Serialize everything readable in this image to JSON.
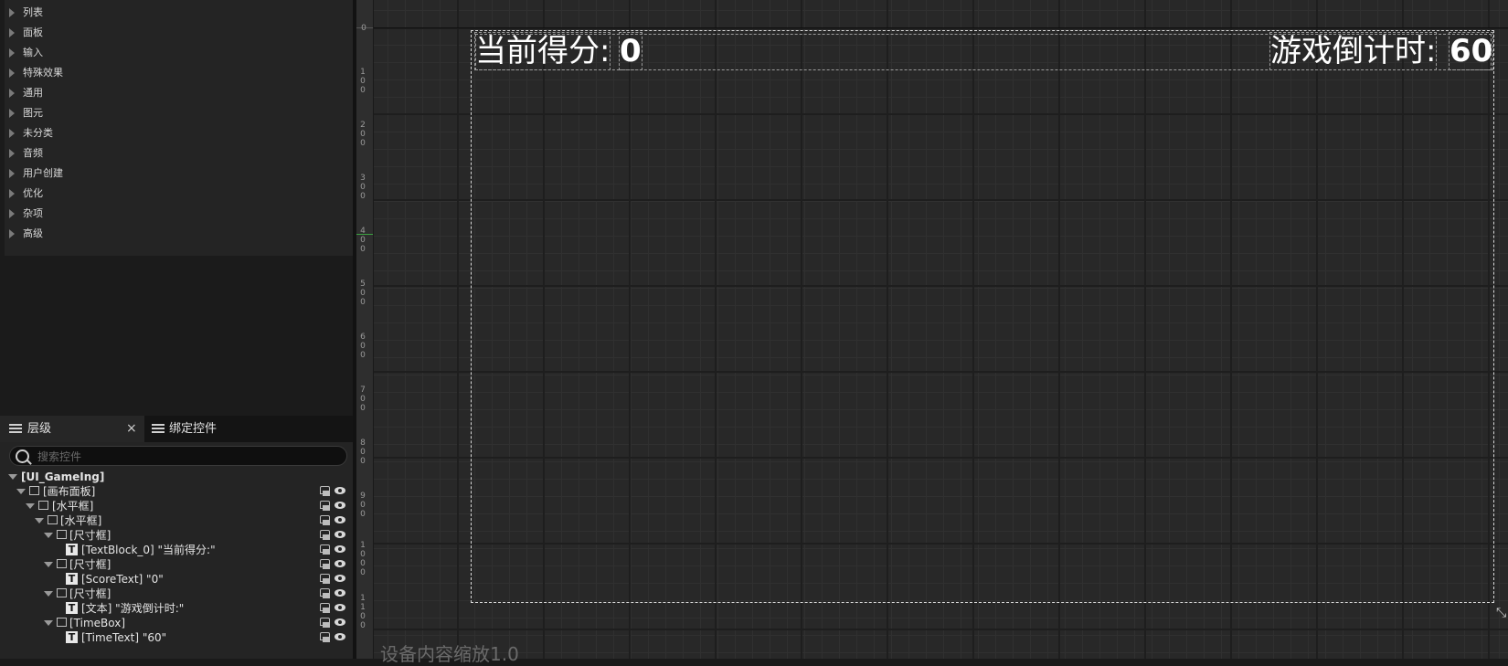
{
  "palette": {
    "categories": [
      "列表",
      "面板",
      "输入",
      "特殊效果",
      "通用",
      "图元",
      "未分类",
      "音频",
      "用户创建",
      "优化",
      "杂项",
      "高级"
    ]
  },
  "hierarchy": {
    "tab_label": "层级",
    "tab_close": "×",
    "bind_tab_label": "绑定控件",
    "search_placeholder": "搜索控件",
    "root": "[UI_GameIng]",
    "rows": [
      {
        "label": "[画布面板]"
      },
      {
        "label": "[水平框]"
      },
      {
        "label": "[水平框]"
      },
      {
        "label": "[尺寸框]"
      },
      {
        "label": "[TextBlock_0] \"当前得分:\""
      },
      {
        "label": "[尺寸框]"
      },
      {
        "label": "[ScoreText] \"0\""
      },
      {
        "label": "[尺寸框]"
      },
      {
        "label": "[文本] \"游戏倒计时:\""
      },
      {
        "label": "[TimeBox]"
      },
      {
        "label": "[TimeText] \"60\""
      }
    ]
  },
  "canvas": {
    "score_label": "当前得分:",
    "score_value": "0",
    "time_label": "游戏倒计时:",
    "time_value": "60",
    "dpi_scale_text": "设备内容缩放1.0",
    "ruler_labels": [
      "0",
      "100",
      "200",
      "300",
      "400",
      "500",
      "600",
      "700",
      "800",
      "900",
      "1000",
      "1100"
    ]
  }
}
